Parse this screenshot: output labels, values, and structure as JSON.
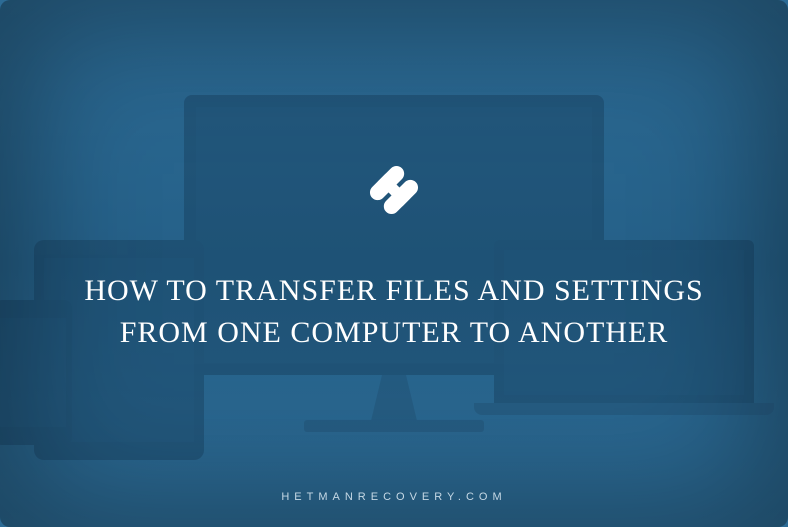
{
  "title": "HOW TO TRANSFER FILES AND SETTINGS FROM ONE COMPUTER TO ANOTHER",
  "footer": "HETMANRECOVERY.COM",
  "logo": {
    "name": "hetman-logo"
  }
}
